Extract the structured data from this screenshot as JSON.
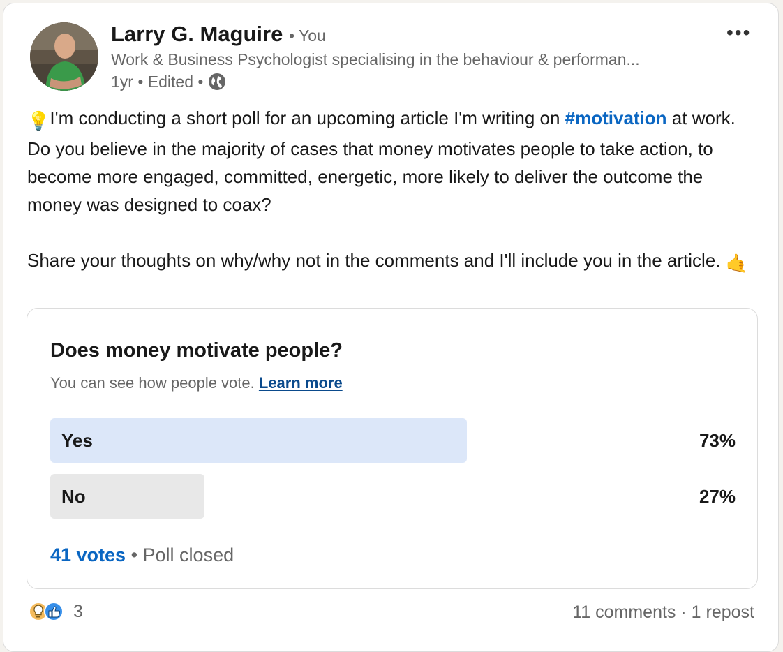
{
  "author": {
    "name": "Larry G. Maguire",
    "relation": "• You",
    "headline": "Work & Business Psychologist specialising in the behaviour & performan...",
    "meta": "1yr • Edited •"
  },
  "post": {
    "bulb_emoji": "💡",
    "text_before_tag": "I'm conducting a short poll for an upcoming article I'm writing on ",
    "hashtag": "#motivation",
    "text_after_tag": " at work. Do you believe in the majority of cases that money motivates people to take action, to become more engaged, committed, energetic, more likely to deliver the outcome the money was designed to coax?",
    "paragraph2": "Share your thoughts on why/why not in the comments and I'll include you in the article. ",
    "hand_emoji": "🤙"
  },
  "poll": {
    "question": "Does money motivate people?",
    "subtitle": "You can see how people vote.",
    "learn_more": "Learn more",
    "options": [
      {
        "label": "Yes",
        "percent_text": "73%",
        "percent": 73,
        "bar_color": "#dce7f9"
      },
      {
        "label": "No",
        "percent_text": "27%",
        "percent": 27,
        "bar_color": "#e8e8e8"
      }
    ],
    "votes": "41 votes",
    "status": " • Poll closed"
  },
  "social": {
    "reaction_icons": [
      "lightbulb-reaction-icon",
      "like-reaction-icon"
    ],
    "reaction_count": "3",
    "comments": "11 comments",
    "separator": " · ",
    "reposts": "1 repost"
  },
  "colors": {
    "accent": "#0a66c2",
    "learn_more": "#0a4a8c",
    "secondary_text": "#666666"
  }
}
